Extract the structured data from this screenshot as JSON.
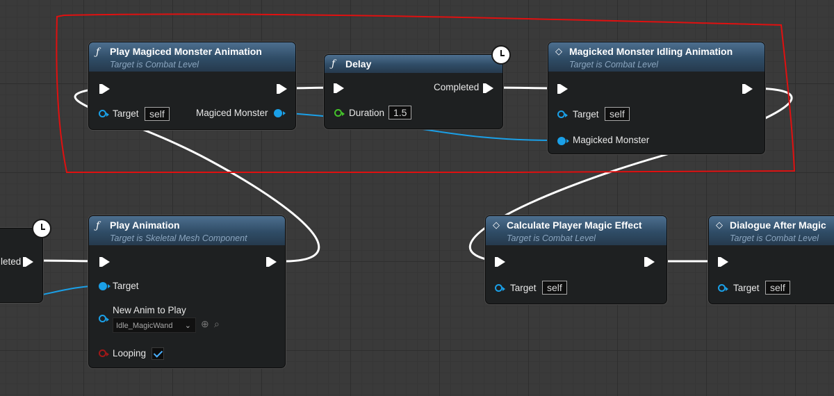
{
  "nodes": {
    "play_magiced": {
      "icon": "function-icon",
      "title": "Play Magiced Monster Animation",
      "subtitle": "Target is Combat Level",
      "pin_target": "Target",
      "target_value": "self",
      "pin_output": "Magiced Monster"
    },
    "delay": {
      "icon": "function-icon",
      "title": "Delay",
      "pin_completed": "Completed",
      "pin_duration": "Duration",
      "duration_value": "1.5"
    },
    "idling": {
      "icon": "event-icon",
      "title": "Magicked Monster Idling Animation",
      "subtitle": "Target is Combat Level",
      "pin_target": "Target",
      "target_value": "self",
      "pin_monster": "Magicked Monster"
    },
    "partial_left": {
      "pin_completed": "leted"
    },
    "play_animation": {
      "icon": "function-icon",
      "title": "Play Animation",
      "subtitle": "Target is Skeletal Mesh Component",
      "pin_target": "Target",
      "pin_new_anim": "New Anim to Play",
      "anim_value": "Idle_MagicWand",
      "pin_looping": "Looping"
    },
    "calc_magic": {
      "icon": "event-icon",
      "title": "Calculate Player Magic Effect",
      "subtitle": "Target is Combat Level",
      "pin_target": "Target",
      "target_value": "self"
    },
    "dialogue": {
      "icon": "event-icon",
      "title": "Dialogue After Magic",
      "subtitle": "Target is Combat Level",
      "pin_target": "Target",
      "target_value": "self"
    }
  },
  "glyphs": {
    "function": "ƒ",
    "event": "◇",
    "chevron": "⌄",
    "add": "⊕",
    "search": "⌕"
  },
  "colors": {
    "exec_wire": "#ffffff",
    "object_wire": "#1aa0e8",
    "highlight": "#e01010"
  }
}
